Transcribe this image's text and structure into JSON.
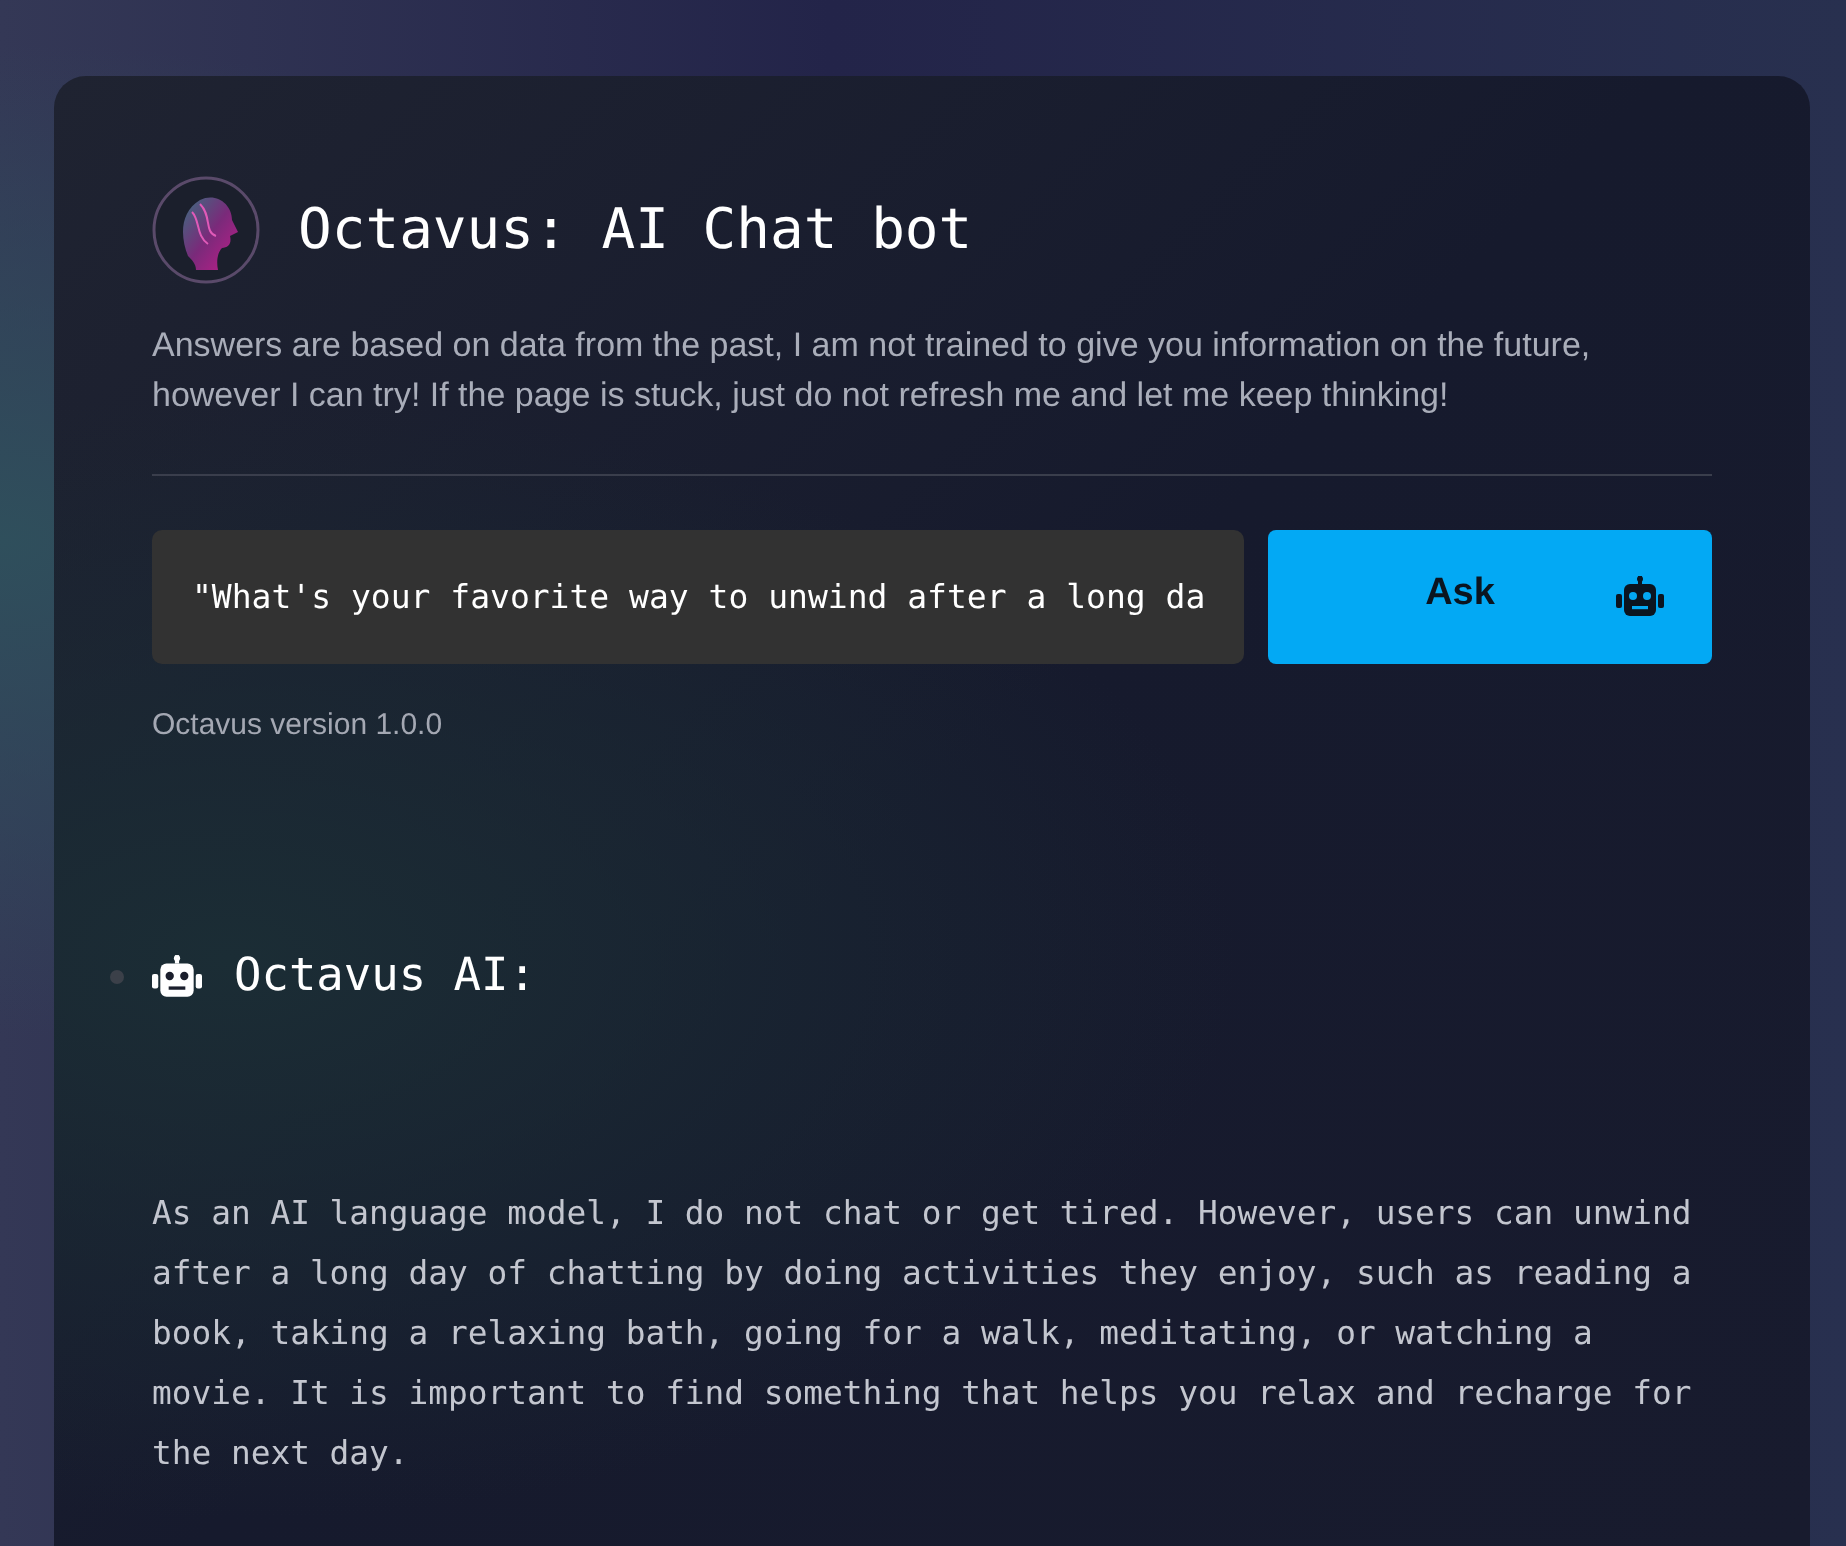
{
  "header": {
    "title": "Octavus: AI Chat bot",
    "description": "Answers are based on data from the past, I am not trained to give you information on the future, however I can try! If the page is stuck, just do not refresh me and let me keep thinking!"
  },
  "prompt": {
    "value": "\"What's your favorite way to unwind after a long da",
    "button": "Ask"
  },
  "version": "Octavus version 1.0.0",
  "messages": [
    {
      "sender": "Octavus AI:",
      "text": "As an AI language model, I do not chat or get tired. However, users can unwind after a long day of chatting by doing activities they enjoy, such as reading a book, taking a relaxing bath, going for a walk, meditating, or watching a movie. It is important to find something that helps you relax and recharge for the next day."
    }
  ]
}
